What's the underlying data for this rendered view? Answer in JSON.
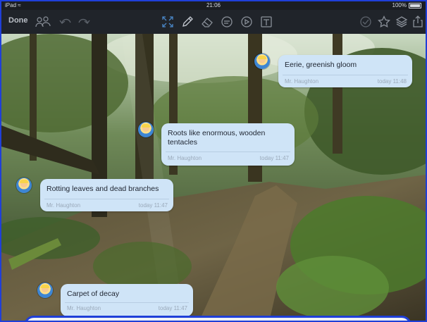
{
  "status_bar": {
    "device": "iPad",
    "time": "21:06",
    "battery": "100%"
  },
  "toolbar": {
    "done_label": "Done"
  },
  "comments": [
    {
      "text": "Eerie, greenish gloom",
      "author": "Mr. Haughton",
      "time": "today 11:48"
    },
    {
      "text": "Roots like enormous, wooden tentacles",
      "author": "Mr. Haughton",
      "time": "today 11:47"
    },
    {
      "text": "Rotting leaves and dead branches",
      "author": "Mr. Haughton",
      "time": "today 11:47"
    },
    {
      "text": "Carpet of decay",
      "author": "Mr. Haughton",
      "time": "today 11:47"
    }
  ],
  "colors": {
    "focus_border": "#1f3fd8",
    "pen_indicator": "#d8233a",
    "bubble": "#cfe4f7"
  }
}
